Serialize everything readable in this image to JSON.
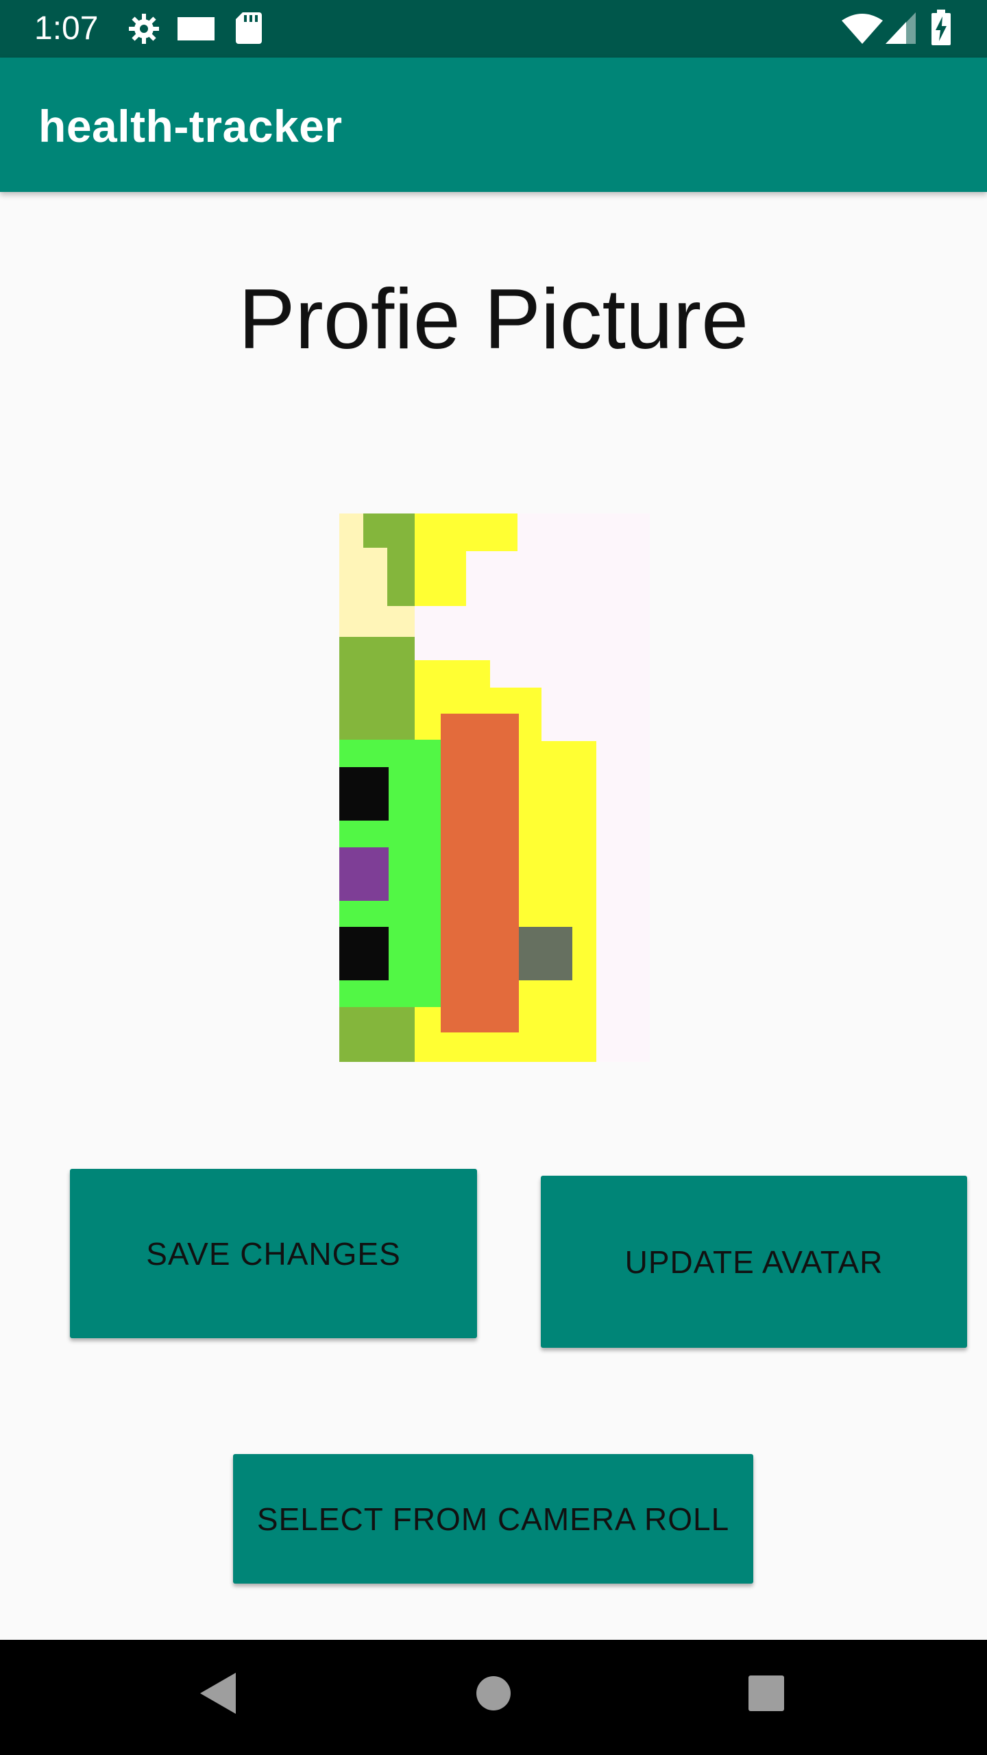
{
  "status_bar": {
    "time": "1:07",
    "icons_left": [
      "gear-icon",
      "screen-icon",
      "sd-card-icon"
    ],
    "icons_right": [
      "wifi-icon",
      "signal-icon",
      "battery-charging-icon"
    ]
  },
  "app_bar": {
    "title": "health-tracker"
  },
  "main": {
    "heading": "Profie Picture",
    "avatar_image": "pixel-art-avatar"
  },
  "buttons": {
    "save_changes": "SAVE CHANGES",
    "update_avatar": "UPDATE AVATAR",
    "select_camera_roll": "SELECT FROM CAMERA ROLL"
  },
  "nav_bar": {
    "icons": [
      "back-icon",
      "home-icon",
      "recents-icon"
    ]
  },
  "colors": {
    "status_bar": "#00574b",
    "app_bar": "#008577",
    "button": "#008577",
    "background": "#fafafa"
  }
}
